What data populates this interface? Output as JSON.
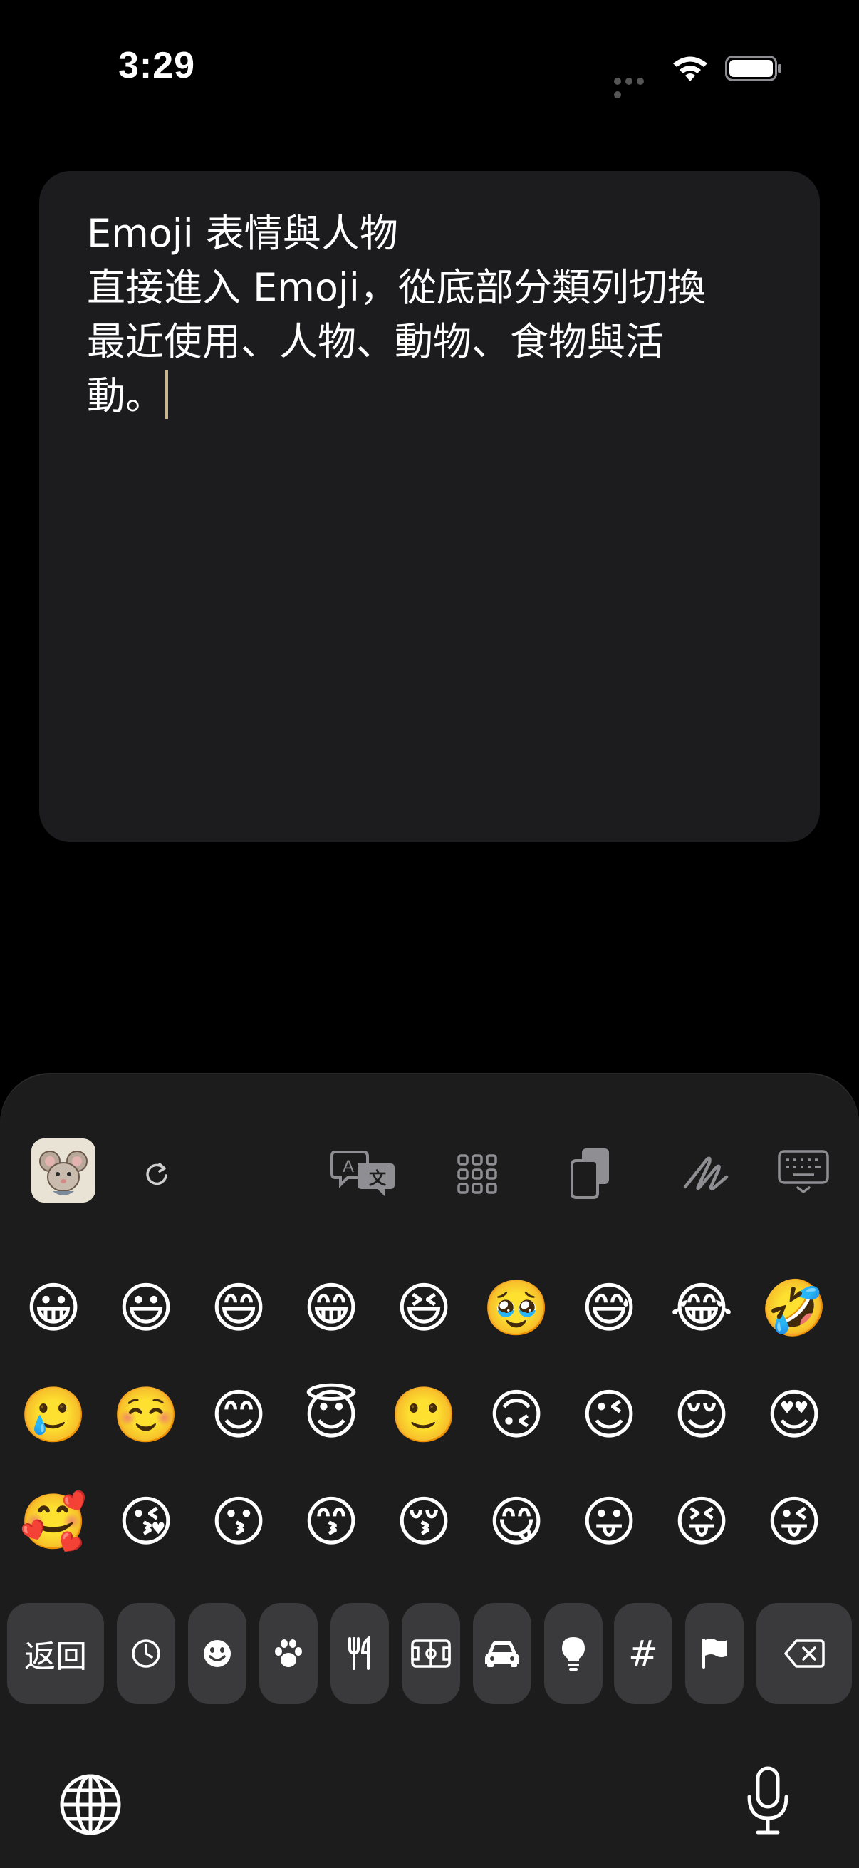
{
  "status_bar": {
    "time": "3:29",
    "signal_icon": "signal-dots-icon",
    "wifi_icon": "wifi-icon",
    "battery_icon": "battery-icon"
  },
  "note": {
    "lines": [
      "Emoji 表情與人物",
      "直接進入 Emoji，從底部分類列切換",
      "最近使用、人物、動物、食物與活",
      "動。"
    ]
  },
  "toolbar": {
    "avatar_icon": "mouse-avatar-icon",
    "items": [
      {
        "name": "refresh-icon"
      },
      {
        "name": "translate-icon"
      },
      {
        "name": "grid-apps-icon"
      },
      {
        "name": "clipboard-icon"
      },
      {
        "name": "handwriting-icon"
      },
      {
        "name": "keyboard-hide-icon"
      }
    ]
  },
  "emojis": {
    "row1": [
      "😀",
      "😃",
      "😄",
      "😁",
      "😆",
      "🥹",
      "😅",
      "😂",
      "🤣"
    ],
    "row2": [
      "🥲",
      "☺️",
      "😊",
      "😇",
      "🙂",
      "🙃",
      "😉",
      "😌",
      "😍"
    ],
    "row3": [
      "🥰",
      "😘",
      "😗",
      "😙",
      "😚",
      "😋",
      "😛",
      "😝",
      "😜"
    ]
  },
  "categories": {
    "back_label": "返回",
    "items": [
      "recent-clock-icon",
      "smiley-icon",
      "paw-icon",
      "fork-knife-icon",
      "soccer-field-icon",
      "car-icon",
      "lightbulb-icon",
      "hash-icon",
      "flag-icon"
    ],
    "hash_label": "#",
    "delete_icon": "delete-backspace-icon"
  },
  "bottom": {
    "globe_icon": "globe-icon",
    "mic_icon": "microphone-icon"
  },
  "colors": {
    "background": "#000000",
    "card": "#1c1c1e",
    "keyboard": "#1c1c1c",
    "key": "#3a3a3c",
    "caret": "#c8b58b",
    "icon": "#8e8e93"
  }
}
